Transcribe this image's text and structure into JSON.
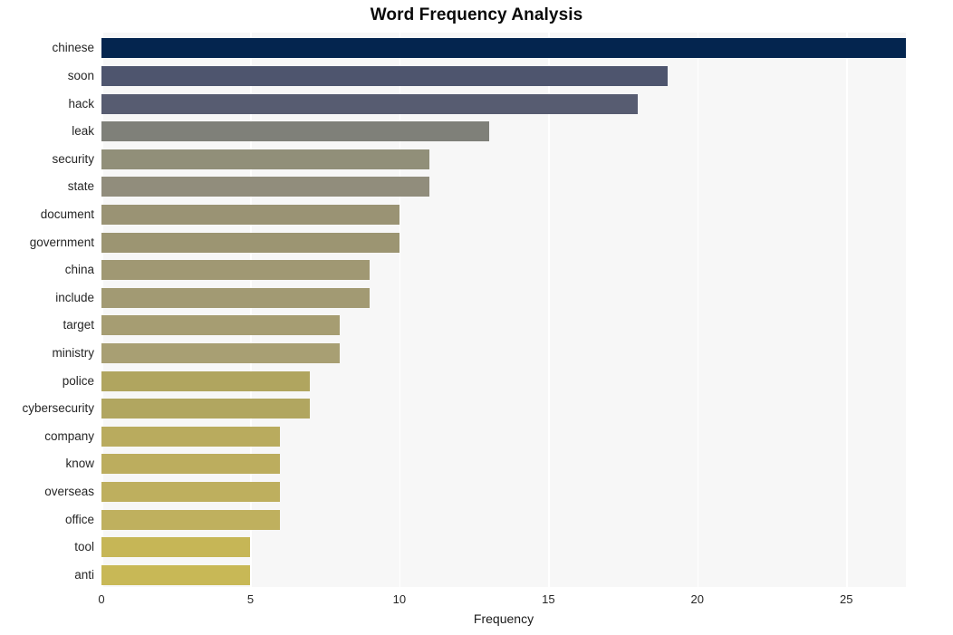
{
  "chart_data": {
    "type": "bar",
    "orientation": "horizontal",
    "title": "Word Frequency Analysis",
    "xlabel": "Frequency",
    "ylabel": "",
    "categories": [
      "chinese",
      "soon",
      "hack",
      "leak",
      "security",
      "state",
      "document",
      "government",
      "china",
      "include",
      "target",
      "ministry",
      "police",
      "cybersecurity",
      "company",
      "know",
      "overseas",
      "office",
      "tool",
      "anti"
    ],
    "values": [
      27,
      19,
      18,
      13,
      11,
      11,
      10,
      10,
      9,
      9,
      8,
      8,
      7,
      7,
      6,
      6,
      6,
      6,
      5,
      5
    ],
    "bar_colors": [
      "#04254f",
      "#4e556e",
      "#575c71",
      "#7f8079",
      "#918f79",
      "#918d7c",
      "#9a9374",
      "#9c9572",
      "#a09873",
      "#a29a73",
      "#a69d72",
      "#a89f73",
      "#b0a55f",
      "#b1a660",
      "#b9ab5e",
      "#bcad5e",
      "#beaf5e",
      "#bfb05e",
      "#c6b656",
      "#c8b856"
    ],
    "xlim": [
      0,
      27
    ],
    "xticks": [
      0,
      5,
      10,
      15,
      20,
      25
    ],
    "xtick_labels": [
      "0",
      "5",
      "10",
      "15",
      "20",
      "25"
    ],
    "grid": {
      "vertical": true,
      "horizontal": false,
      "color": "#ffffff"
    },
    "legend": null,
    "plot_background": "#f7f7f7",
    "figure_background": "#ffffff"
  }
}
